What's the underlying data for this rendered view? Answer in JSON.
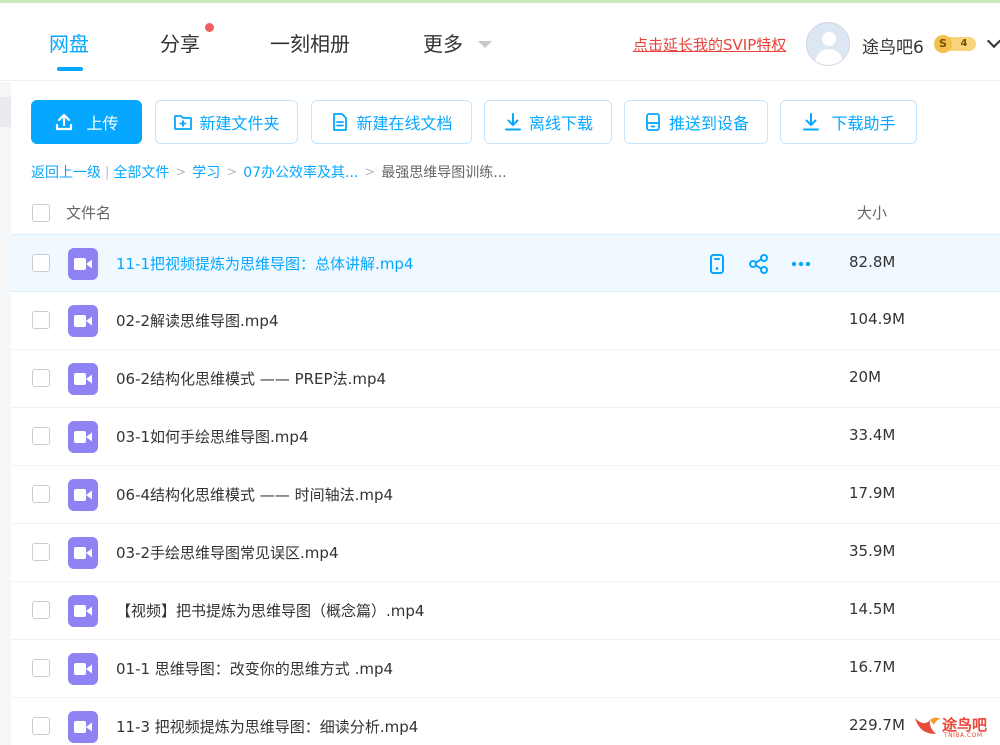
{
  "nav": {
    "tabs": [
      {
        "label": "网盘"
      },
      {
        "label": "分享"
      },
      {
        "label": "一刻相册"
      },
      {
        "label": "更多"
      }
    ]
  },
  "user": {
    "svip_link": "点击延长我的SVIP特权",
    "name": "途鸟吧6",
    "vip_badge_letter": "S",
    "vip_level": "4"
  },
  "toolbar": {
    "upload": "上传",
    "new_folder": "新建文件夹",
    "new_doc": "新建在线文档",
    "offline_download": "离线下载",
    "push_device": "推送到设备",
    "download_helper": "下载助手"
  },
  "breadcrumb": {
    "back": "返回上一级",
    "items": [
      "全部文件",
      "学习",
      "07办公效率及其..."
    ],
    "current": "最强思维导图训练..."
  },
  "list": {
    "col_name": "文件名",
    "col_size": "大小",
    "files": [
      {
        "name": "11-1把视频提炼为思维导图：总体讲解.mp4",
        "size": "82.8M"
      },
      {
        "name": "02-2解读思维导图.mp4",
        "size": "104.9M"
      },
      {
        "name": "06-2结构化思维模式 —— PREP法.mp4",
        "size": "20M"
      },
      {
        "name": "03-1如何手绘思维导图.mp4",
        "size": "33.4M"
      },
      {
        "name": "06-4结构化思维模式 —— 时间轴法.mp4",
        "size": "17.9M"
      },
      {
        "name": "03-2手绘思维导图常见误区.mp4",
        "size": "35.9M"
      },
      {
        "name": "【视频】把书提炼为思维导图（概念篇）.mp4",
        "size": "14.5M"
      },
      {
        "name": "01-1 思维导图：改变你的思维方式 .mp4",
        "size": "16.7M"
      },
      {
        "name": "11-3 把视频提炼为思维导图：细读分析.mp4",
        "size": "229.7M"
      }
    ]
  },
  "watermark": {
    "text": "途鸟吧",
    "sub": "TNIBA.COM"
  },
  "colors": {
    "accent": "#06a7ff",
    "svip_red": "#e9423b",
    "video_icon": "#8f82f2"
  }
}
